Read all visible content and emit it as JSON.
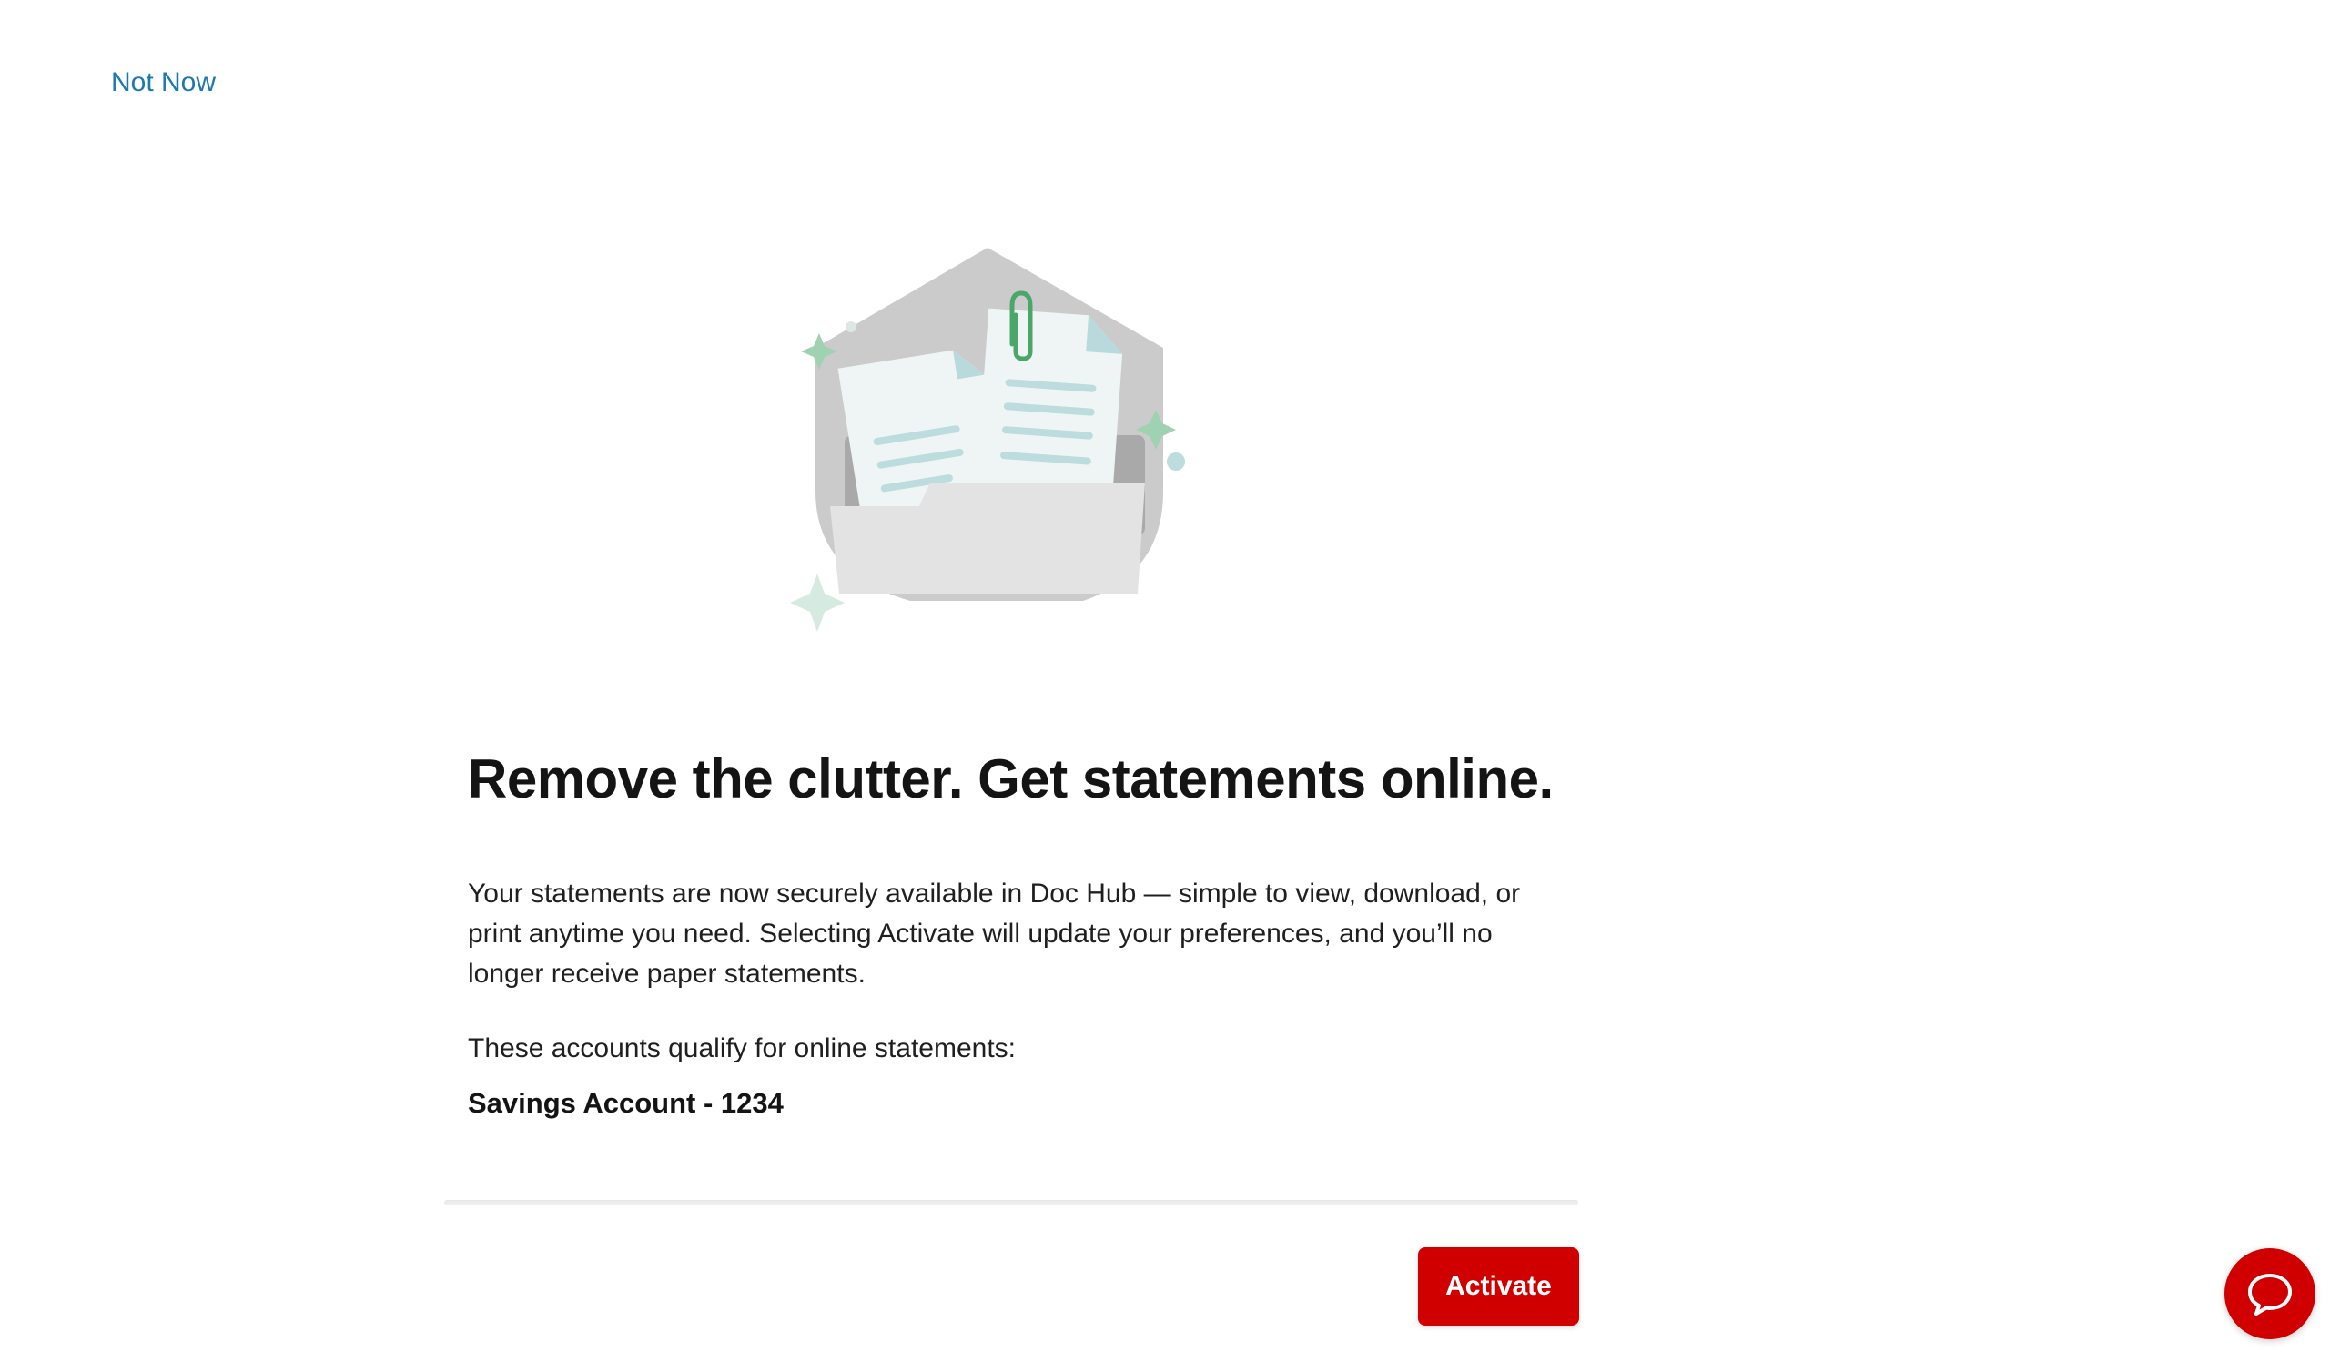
{
  "header": {
    "not_now_label": "Not Now"
  },
  "main": {
    "headline": "Remove the clutter. Get statements online.",
    "body": "Your statements are now securely available in Doc Hub — simple to view, download, or print anytime you need. Selecting Activate will update your preferences, and you’ll no longer receive paper statements.",
    "qualify_text": "These accounts qualify for online statements:",
    "accounts": [
      "Savings Account - 1234"
    ]
  },
  "footer": {
    "activate_label": "Activate"
  },
  "icons": {
    "illustration": "documents-folder-illustration",
    "chat": "chat-bubble-icon"
  },
  "colors": {
    "link": "#1c78b0",
    "brand_red": "#d10000",
    "text": "#141414"
  }
}
